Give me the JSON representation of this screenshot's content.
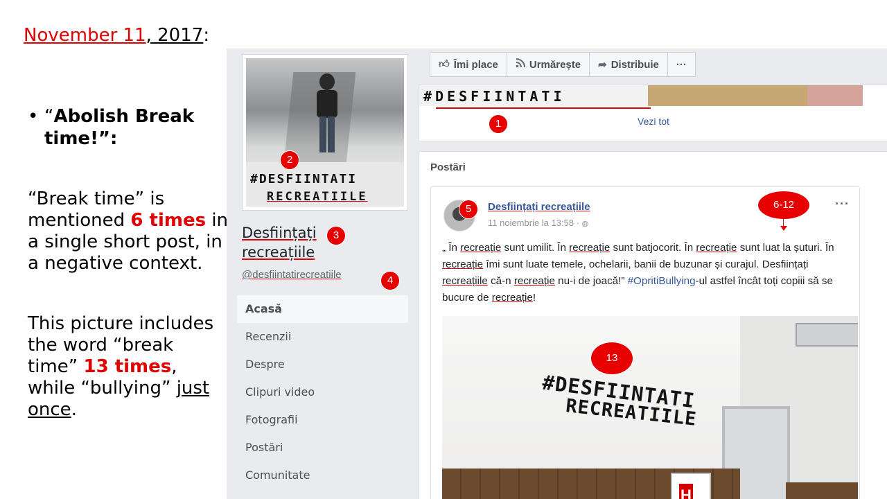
{
  "slide": {
    "date_red": "November 11",
    "date_rest": ", 2017",
    "date_colon": ":",
    "bullet_dot": "•",
    "bullet_open": "“",
    "bullet_text": "Abolish Break time",
    "bullet_close": "!”:",
    "para1_a": "“Break time” is mentioned ",
    "para1_red": "6 times",
    "para1_b": " in a single short post, in a negative context.",
    "para2_a": "This picture includes the word “break time” ",
    "para2_red": "13 times",
    "para2_b": ", while “bullying” ",
    "para2_ul": "just once",
    "para2_c": "."
  },
  "fb": {
    "cover_hash1": "#DESFIINTATI",
    "cover_hash2": "RECREATIILE",
    "page_name_line1": "Desființați",
    "page_name_line2": "recreațiile",
    "page_handle": "@desfiintatirecreatiile",
    "nav": [
      "Acasă",
      "Recenzii",
      "Despre",
      "Clipuri video",
      "Fotografii",
      "Postări",
      "Comunitate"
    ],
    "actions": [
      {
        "icon": "thumbs-up-icon",
        "label": "Îmi place"
      },
      {
        "icon": "rss-icon",
        "label": "Urmărește"
      },
      {
        "icon": "share-icon",
        "label": "Distribuie"
      },
      {
        "icon": "more-icon",
        "label": "···"
      }
    ],
    "strip_text": "#DESFIINTATI",
    "see_all": "Vezi tot",
    "posts_title": "Postări",
    "post": {
      "author": "Desființați recreațiile",
      "time": "11 noiembrie la 13:58 · ",
      "more": "···",
      "text": {
        "t1": "„ În ",
        "w1": "recreație",
        "t2": " sunt umilit. În ",
        "w2": "recreație",
        "t3": " sunt batjocorit. În ",
        "w3": "recreație",
        "t4": " sunt luat la șuturi. În ",
        "w4": "recreație",
        "t5": " îmi sunt luate temele, ochelarii, banii de buzunar și curajul. Desființați ",
        "w5": "recreațiile",
        "t6": " că-n ",
        "w6": "recreație",
        "t7": " nu-i de joacă!” ",
        "tag": "#OpritiBullying",
        "t8": "-ul astfel încât toți copiii să se bucure de ",
        "w7": "recreație",
        "t9": "!"
      },
      "graffiti1": "#DESFIINTATI",
      "graffiti2": "RECREATIILE",
      "sign": "H"
    }
  },
  "badges": {
    "b1": "1",
    "b2": "2",
    "b3": "3",
    "b4": "4",
    "b5": "5",
    "b6": "6-12",
    "b13": "13"
  },
  "colors": {
    "accent_red": "#e00000",
    "fb_link": "#365899",
    "fb_bg": "#e9ebee"
  }
}
